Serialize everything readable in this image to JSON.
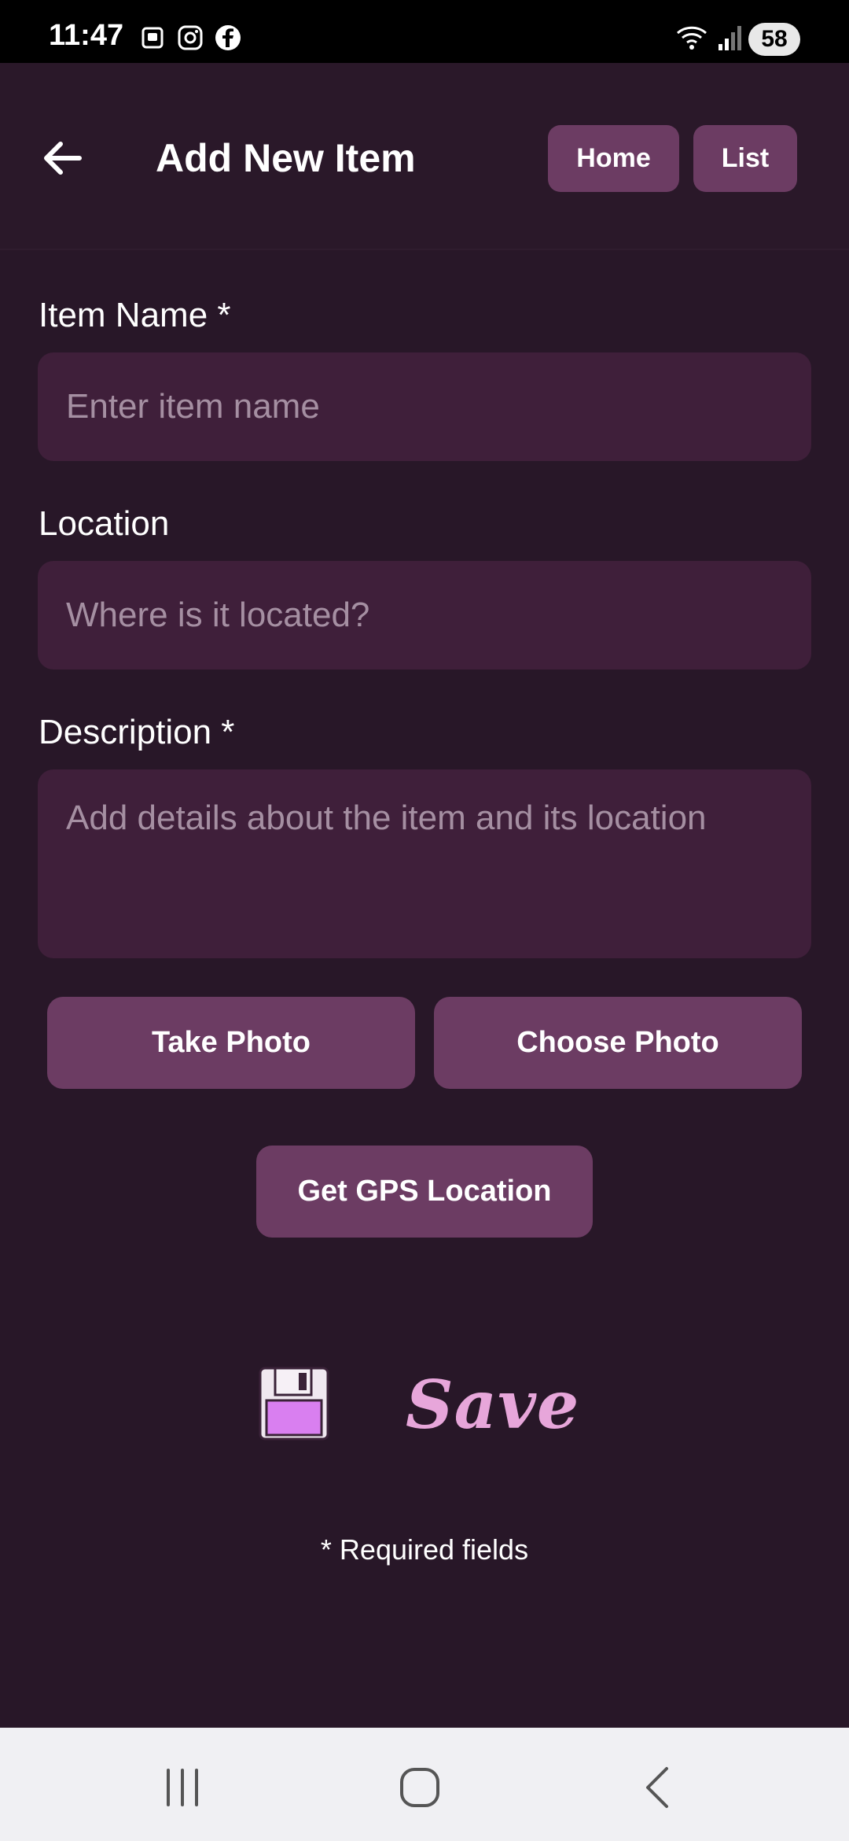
{
  "status_bar": {
    "time": "11:47",
    "battery": "58",
    "left_icons": [
      "screenshot-icon",
      "instagram-icon",
      "facebook-icon"
    ],
    "right_icons": [
      "wifi-icon",
      "signal-icon"
    ]
  },
  "header": {
    "title": "Add New Item",
    "home_label": "Home",
    "list_label": "List"
  },
  "form": {
    "item_name": {
      "label": "Item Name *",
      "placeholder": "Enter item name",
      "value": ""
    },
    "location": {
      "label": "Location",
      "placeholder": "Where is it located?",
      "value": ""
    },
    "description": {
      "label": "Description *",
      "placeholder": "Add details about the item and its location",
      "value": ""
    }
  },
  "actions": {
    "take_photo": "Take Photo",
    "choose_photo": "Choose Photo",
    "gps": "Get GPS Location",
    "save": "Save"
  },
  "footer_note": "* Required fields",
  "colors": {
    "background": "#281728",
    "button": "#6c3c63",
    "field": "#3f1f3a",
    "save_text": "#e7a6da",
    "floppy": "#d97ff0"
  }
}
